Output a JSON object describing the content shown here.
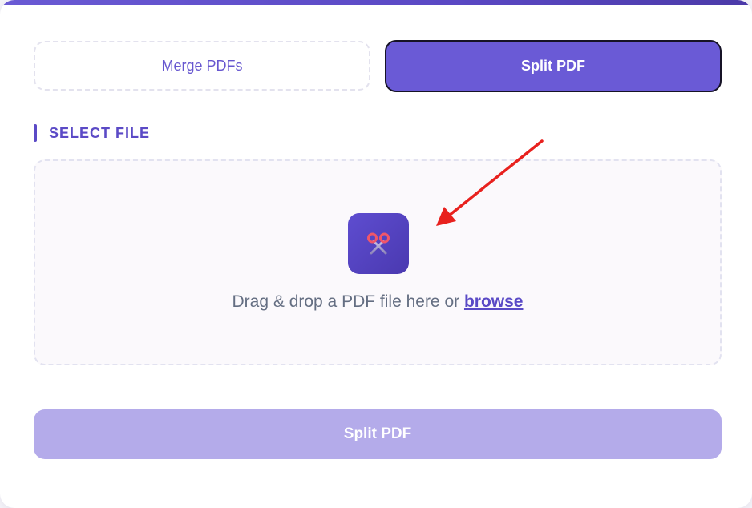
{
  "tabs": {
    "merge_label": "Merge PDFs",
    "split_label": "Split PDF",
    "active": "split"
  },
  "section": {
    "title": "SELECT FILE"
  },
  "dropzone": {
    "text": "Drag & drop a PDF file here or ",
    "link_label": "browse",
    "icon": "scissors-icon"
  },
  "submit": {
    "label": "Split PDF",
    "disabled": true
  },
  "colors": {
    "accent": "#6a5ad6",
    "accent_dark": "#5b4ac6",
    "disabled_button": "#b4abea",
    "annotation_arrow": "#e8211e"
  }
}
